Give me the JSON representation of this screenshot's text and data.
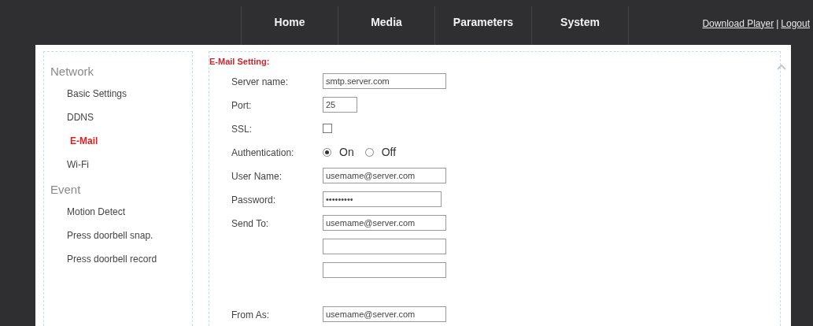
{
  "nav": {
    "tabs": [
      {
        "label": "Home",
        "selected": false
      },
      {
        "label": "Media",
        "selected": false
      },
      {
        "label": "Parameters",
        "selected": false
      },
      {
        "label": "System",
        "selected": false
      }
    ],
    "links": [
      "Download Player",
      "Logout"
    ],
    "link_separator": "|"
  },
  "sidebar": {
    "groups": [
      {
        "title": "Network",
        "items": [
          {
            "label": "Basic Settings",
            "selected": false
          },
          {
            "label": "DDNS",
            "selected": false
          },
          {
            "label": "E-Mail",
            "selected": true
          },
          {
            "label": "Wi-Fi",
            "selected": false
          }
        ]
      },
      {
        "title": "Event",
        "items": [
          {
            "label": "Motion Detect",
            "selected": false
          },
          {
            "label": "Press doorbell snap.",
            "selected": false
          },
          {
            "label": "Press doorbell record",
            "selected": false
          }
        ]
      }
    ]
  },
  "form": {
    "title": "E-Mail Setting:",
    "fields": [
      {
        "kind": "text",
        "label": "Server name:",
        "value": "smtp.server.com"
      },
      {
        "kind": "short_text",
        "label": "Port:",
        "value": "25"
      },
      {
        "kind": "checkbox",
        "label": "SSL:",
        "checked": false
      },
      {
        "kind": "radio",
        "label": "Authentication:",
        "options": [
          {
            "label": "On",
            "selected": true
          },
          {
            "label": "Off",
            "selected": false
          }
        ]
      },
      {
        "kind": "text",
        "label": "User Name:",
        "value": "usemame@server.com"
      },
      {
        "kind": "password",
        "label": "Password:",
        "value": "•••••••••"
      },
      {
        "kind": "text",
        "label": "Send To:",
        "value": "usemame@server.com"
      },
      {
        "kind": "text"
      },
      {
        "kind": "text"
      },
      {
        "kind": "text",
        "label": "From As:",
        "value": "usemame@server.com"
      }
    ]
  }
}
